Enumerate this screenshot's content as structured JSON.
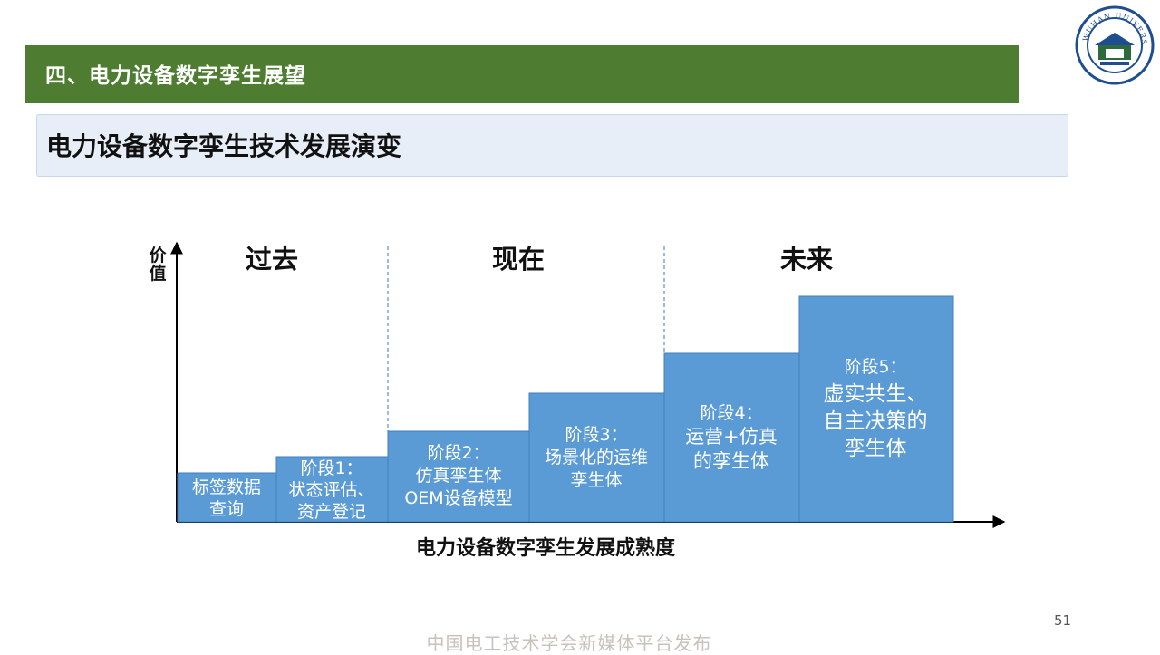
{
  "header": {
    "title": "四、电力设备数字孪生展望"
  },
  "subtitle": "电力设备数字孪生技术发展演变",
  "logo": {
    "text": "WUHAN UNIVERSITY",
    "icon": "university-seal"
  },
  "diagram": {
    "eras": [
      "过去",
      "现在",
      "未来"
    ],
    "y_axis_label": [
      "价",
      "值"
    ],
    "x_axis_label": "电力设备数字孪生发展成熟度",
    "bar_color": "#5b9bd5",
    "stages": [
      {
        "lines": [
          "标签数据",
          "查询"
        ]
      },
      {
        "lines": [
          "阶段1：",
          "状态评估、",
          "资产登记"
        ]
      },
      {
        "lines": [
          "阶段2：",
          "仿真孪生体",
          "OEM设备模型"
        ]
      },
      {
        "lines": [
          "阶段3：",
          "场景化的运维",
          "孪生体"
        ]
      },
      {
        "lines": [
          "阶段4：",
          "运营+仿真",
          "的孪生体"
        ]
      },
      {
        "lines": [
          "阶段5：",
          "虚实共生、",
          "自主决策的",
          "孪生体"
        ]
      }
    ]
  },
  "page_number": "51",
  "footer": "中国电工技术学会新媒体平台发布"
}
